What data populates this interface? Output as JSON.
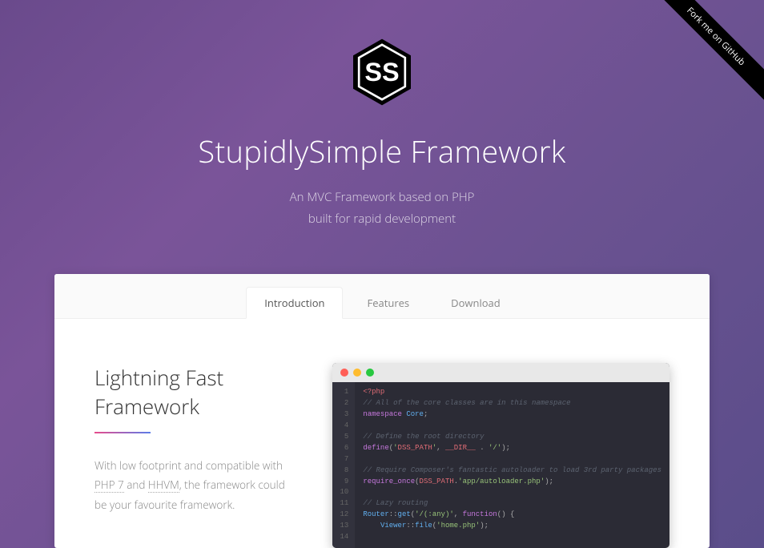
{
  "ribbon": {
    "label": "Fork me on GitHub"
  },
  "hero": {
    "title": "StupidlySimple Framework",
    "subtitle_line1": "An MVC Framework based on PHP",
    "subtitle_line2": "built for rapid development"
  },
  "tabs": {
    "items": [
      {
        "label": "Introduction",
        "active": true
      },
      {
        "label": "Features",
        "active": false
      },
      {
        "label": "Download",
        "active": false
      }
    ]
  },
  "section": {
    "title": "Lightning Fast Framework",
    "text_prefix": "With low footprint and compatible with ",
    "link1": "PHP 7",
    "text_mid": " and ",
    "link2": "HHVM",
    "text_suffix": ", the framework could be your favourite framework."
  },
  "code": {
    "line_numbers": [
      "1",
      "2",
      "3",
      "4",
      "5",
      "6",
      "7",
      "8",
      "9",
      "10",
      "11",
      "12",
      "13",
      "14"
    ],
    "lines": [
      {
        "type": "tag",
        "text": "<?php"
      },
      {
        "type": "comment",
        "text": "// All of the core classes are in this namespace"
      },
      {
        "type": "code",
        "text": "namespace Core;"
      },
      {
        "type": "blank",
        "text": ""
      },
      {
        "type": "comment",
        "text": "// Define the root directory"
      },
      {
        "type": "code",
        "text": "define('DSS_PATH', __DIR__ . '/');"
      },
      {
        "type": "blank",
        "text": ""
      },
      {
        "type": "comment",
        "text": "// Require Composer's fantastic autoloader to load 3rd party packages"
      },
      {
        "type": "code",
        "text": "require_once(DSS_PATH.'app/autoloader.php');"
      },
      {
        "type": "blank",
        "text": ""
      },
      {
        "type": "comment",
        "text": "// Lazy routing"
      },
      {
        "type": "code",
        "text": "Router::get('/(:any)', function() {"
      },
      {
        "type": "code",
        "text": "    Viewer::file('home.php');"
      },
      {
        "type": "blank",
        "text": ""
      }
    ]
  }
}
